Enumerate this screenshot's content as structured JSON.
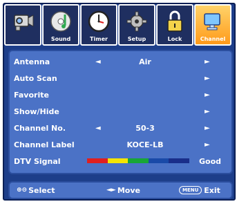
{
  "tabs": [
    {
      "label": "",
      "icon": "camcorder-icon"
    },
    {
      "label": "Sound",
      "icon": "music-cd-icon"
    },
    {
      "label": "Timer",
      "icon": "clock-icon"
    },
    {
      "label": "Setup",
      "icon": "gear-icon"
    },
    {
      "label": "Lock",
      "icon": "padlock-icon"
    },
    {
      "label": "Channel",
      "icon": "monitor-icon",
      "active": true
    }
  ],
  "menu": {
    "rows": [
      {
        "name": "Antenna",
        "value": "Air",
        "left_arrow": "◄",
        "right_arrow": "►"
      },
      {
        "name": "Auto Scan",
        "value": "",
        "left_arrow": "",
        "right_arrow": "►"
      },
      {
        "name": "Favorite",
        "value": "",
        "left_arrow": "",
        "right_arrow": "►"
      },
      {
        "name": "Show/Hide",
        "value": "",
        "left_arrow": "",
        "right_arrow": "►"
      },
      {
        "name": "Channel No.",
        "value": "50-3",
        "left_arrow": "◄",
        "right_arrow": "►"
      },
      {
        "name": "Channel Label",
        "value": "KOCE-LB",
        "left_arrow": "",
        "right_arrow": "►"
      },
      {
        "name": "DTV Signal",
        "value": "Good",
        "left_arrow": "",
        "right_arrow": ""
      }
    ],
    "dtv_signal_colors": [
      "#e01f1f",
      "#f5e400",
      "#18a636",
      "#1a4aa8",
      "#1a2e8a"
    ]
  },
  "footer": {
    "select_icon": "⊕⊖",
    "select_label": "Select",
    "move_icon": "◄►",
    "move_label": "Move",
    "exit_chip": "MENU",
    "exit_label": "Exit"
  },
  "colors": {
    "frame": "#1d3e8a",
    "panel": "#4b72c6",
    "active_tab": "#ff9a1a"
  }
}
